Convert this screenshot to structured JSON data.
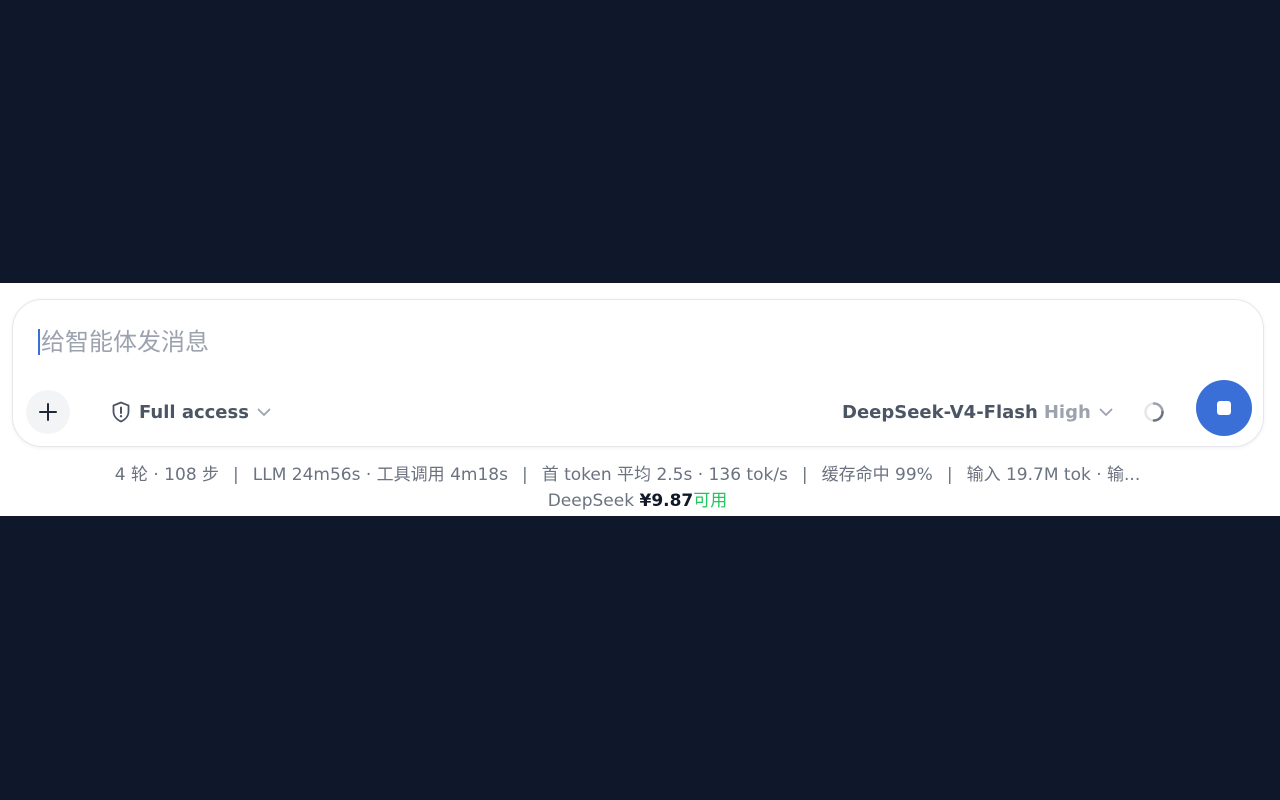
{
  "composer": {
    "placeholder": "给智能体发消息",
    "access": {
      "label": "Full access",
      "icon": "shield-alert-icon"
    },
    "model": {
      "name": "DeepSeek-V4-Flash",
      "effort": "High"
    },
    "icons": {
      "plus": "plus-icon",
      "chevron": "chevron-down-icon",
      "spinner": "loading-spinner-icon",
      "stop": "stop-icon"
    }
  },
  "stats": {
    "rounds": "4 轮 · 108 步",
    "timing": "LLM 24m56s · 工具调用 4m18s",
    "first_token": "首 token 平均 2.5s · 136 tok/s",
    "cache": "缓存命中 99%",
    "tokens": "输入 19.7M tok · 输...",
    "separator": "|"
  },
  "balance": {
    "provider": "DeepSeek",
    "amount": "¥9.87",
    "status": "可用"
  },
  "colors": {
    "background": "#0f172a",
    "accent": "#3b6fd8",
    "available": "#22c55e"
  }
}
